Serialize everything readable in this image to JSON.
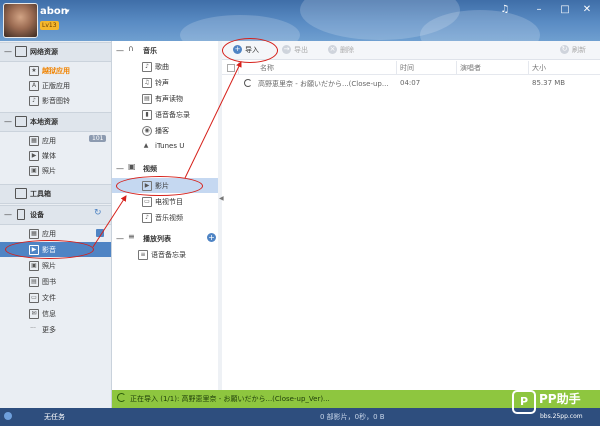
{
  "header": {
    "username": "abon",
    "badge": "Lv13",
    "window_controls": [
      "music-icon",
      "minimize-icon",
      "maximize-icon",
      "close-icon"
    ],
    "window_control_glyphs": [
      "♫",
      "–",
      "□",
      "✕"
    ]
  },
  "leftnav": {
    "sections": [
      {
        "label": "网络资源",
        "items": [
          {
            "label": "越狱应用",
            "icon": "star-icon",
            "highlight": true
          },
          {
            "label": "正版应用",
            "icon": "app-store-icon"
          },
          {
            "label": "影音图铃",
            "icon": "music-note-icon"
          }
        ]
      },
      {
        "label": "本地资源",
        "items": [
          {
            "label": "应用",
            "icon": "grid-icon",
            "count": "101"
          },
          {
            "label": "媒体",
            "icon": "film-icon"
          },
          {
            "label": "照片",
            "icon": "photo-icon"
          }
        ]
      },
      {
        "label": "工具箱"
      },
      {
        "label": "设备",
        "items": [
          {
            "label": "应用",
            "icon": "grid-icon"
          },
          {
            "label": "影音",
            "icon": "film-icon",
            "selected": true
          },
          {
            "label": "照片",
            "icon": "photo-icon"
          },
          {
            "label": "图书",
            "icon": "book-icon"
          },
          {
            "label": "文件",
            "icon": "file-icon"
          },
          {
            "label": "信息",
            "icon": "message-icon"
          },
          {
            "label": "更多",
            "icon": "more-icon"
          }
        ]
      }
    ]
  },
  "midnav": {
    "groups": [
      {
        "label": "音乐",
        "items": [
          "歌曲",
          "铃声",
          "有声读物",
          "语音备忘录",
          "播客",
          "iTunes U"
        ]
      },
      {
        "label": "视频",
        "items": [
          "影片",
          "电视节目",
          "音乐视频"
        ]
      },
      {
        "label": "播放列表",
        "items": [
          "语音备忘录"
        ]
      }
    ],
    "selected": "影片"
  },
  "toolbar": {
    "import": "导入",
    "export": "导出",
    "delete": "删除",
    "refresh": "刷新"
  },
  "table": {
    "columns": [
      "名称",
      "时间",
      "演唱者",
      "大小"
    ],
    "rows": [
      {
        "name": "高野恵里奈 - お願いだから...(Close-up...",
        "time": "04:07",
        "artist": "",
        "size": "85.37 MB"
      }
    ]
  },
  "status": {
    "text": "正在导入 (1/1): 高野恵里奈 - お願いだから...(Close-up_Ver)..."
  },
  "footer": {
    "task_label": "无任务",
    "summary": "0 部影片，0秒，0 B"
  },
  "watermark": {
    "logo": "P",
    "name": "PP助手",
    "url": "bbs.25pp.com"
  },
  "colors": {
    "header": "#4a7bb7",
    "selection": "#4f84c4",
    "status_bar": "#8ec63f",
    "footer": "#2e4e7e",
    "annotation": "#d6201a"
  }
}
